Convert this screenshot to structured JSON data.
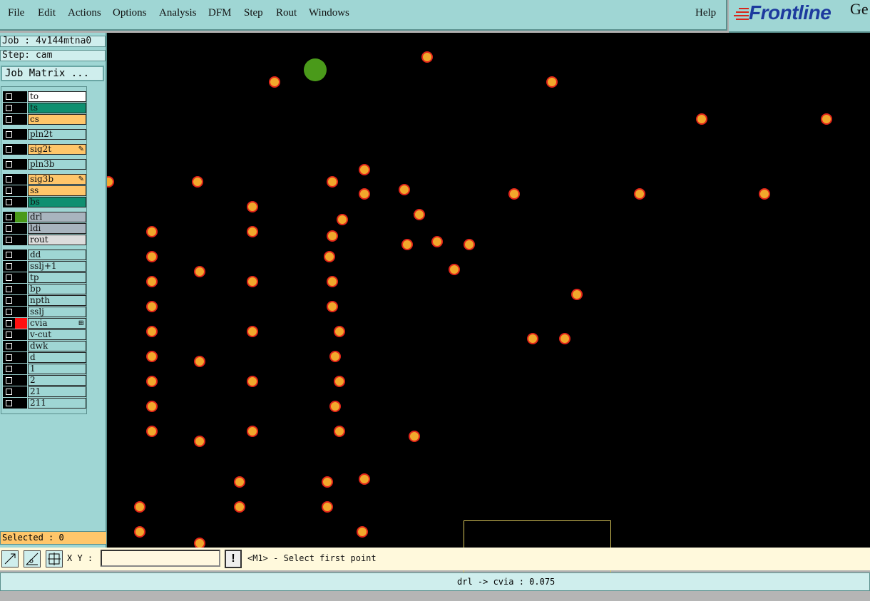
{
  "menubar": {
    "items": [
      "File",
      "Edit",
      "Actions",
      "Options",
      "Analysis",
      "DFM",
      "Step",
      "Rout",
      "Windows"
    ],
    "help": "Help"
  },
  "brand": {
    "name": "Frontline",
    "extra": "Ge"
  },
  "job": {
    "job_label": "Job : 4v144mtna0",
    "step_label": "Step: cam",
    "matrix_button": "Job Matrix ..."
  },
  "layers": [
    {
      "name": "to",
      "color": "#ffffff",
      "swatch": "#000000"
    },
    {
      "name": "ts",
      "color": "#0e8f70",
      "swatch": "#000000"
    },
    {
      "name": "cs",
      "color": "#ffc66a",
      "swatch": "#000000"
    },
    {
      "name": "pln2t",
      "color": "#9fd6d4",
      "swatch": "#000000"
    },
    {
      "name": "sig2t",
      "color": "#ffc66a",
      "swatch": "#000000",
      "mark": "✎"
    },
    {
      "name": "pln3b",
      "color": "#9fd6d4",
      "swatch": "#000000"
    },
    {
      "name": "sig3b",
      "color": "#ffc66a",
      "swatch": "#000000",
      "mark": "✎"
    },
    {
      "name": "ss",
      "color": "#ffc66a",
      "swatch": "#000000"
    },
    {
      "name": "bs",
      "color": "#0e8f70",
      "swatch": "#000000"
    },
    {
      "name": "drl",
      "color": "#a8b4be",
      "swatch": "#4a9a1a"
    },
    {
      "name": "ldi",
      "color": "#a8b4be",
      "swatch": "#000000"
    },
    {
      "name": "rout",
      "color": "#dcdcdc",
      "swatch": "#000000"
    },
    {
      "name": "dd",
      "color": "#9fd6d4",
      "swatch": "#000000"
    },
    {
      "name": "sslj+1",
      "color": "#9fd6d4",
      "swatch": "#000000"
    },
    {
      "name": "tp",
      "color": "#9fd6d4",
      "swatch": "#000000"
    },
    {
      "name": "bp",
      "color": "#9fd6d4",
      "swatch": "#000000"
    },
    {
      "name": "npth",
      "color": "#9fd6d4",
      "swatch": "#000000"
    },
    {
      "name": "sslj",
      "color": "#9fd6d4",
      "swatch": "#000000"
    },
    {
      "name": "cvia",
      "color": "#9fd6d4",
      "swatch": "#ff1010",
      "mark": "⊞"
    },
    {
      "name": "v-cut",
      "color": "#9fd6d4",
      "swatch": "#000000"
    },
    {
      "name": "dwk",
      "color": "#9fd6d4",
      "swatch": "#000000"
    },
    {
      "name": "d",
      "color": "#9fd6d4",
      "swatch": "#000000"
    },
    {
      "name": "1",
      "color": "#9fd6d4",
      "swatch": "#000000"
    },
    {
      "name": "2",
      "color": "#9fd6d4",
      "swatch": "#000000"
    },
    {
      "name": "21",
      "color": "#9fd6d4",
      "swatch": "#000000"
    },
    {
      "name": "211",
      "color": "#9fd6d4",
      "swatch": "#000000"
    }
  ],
  "selected_label": "Selected : 0",
  "bottom": {
    "xy_label": "X Y :",
    "xy_value": "",
    "bang": "!",
    "prompt": "<M1> - Select first point"
  },
  "status": {
    "text": "drl -> cvia : 0.075"
  },
  "colors": {
    "pad_fill": "#f1a82c",
    "pad_ring": "#e3261a",
    "big_pad": "#4a9a1a",
    "panel": "#9fd6d4"
  }
}
